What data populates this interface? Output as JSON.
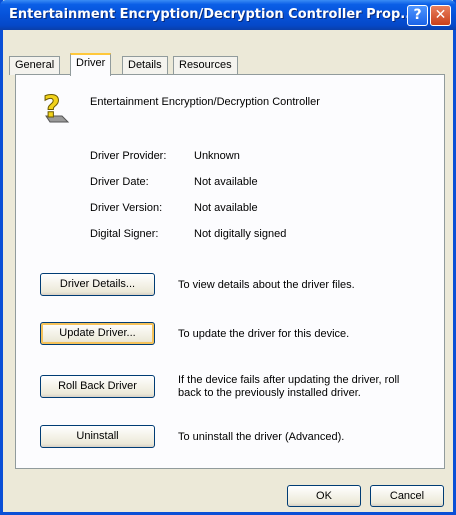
{
  "window": {
    "title": "Entertainment Encryption/Decryption Controller Prop...",
    "help_glyph": "?",
    "close_glyph": "✕"
  },
  "tabs": [
    {
      "label": "General"
    },
    {
      "label": "Driver",
      "active": true
    },
    {
      "label": "Details"
    },
    {
      "label": "Resources"
    }
  ],
  "device": {
    "icon": "unknown-device-icon",
    "name": "Entertainment Encryption/Decryption Controller"
  },
  "info": [
    {
      "label": "Driver Provider:",
      "value": "Unknown"
    },
    {
      "label": "Driver Date:",
      "value": "Not available"
    },
    {
      "label": "Driver Version:",
      "value": "Not available"
    },
    {
      "label": "Digital Signer:",
      "value": "Not digitally signed"
    }
  ],
  "actions": [
    {
      "button": "Driver Details...",
      "description": "To view details about the driver files."
    },
    {
      "button": "Update Driver...",
      "description": "To update the driver for this device."
    },
    {
      "button": "Roll Back Driver",
      "description": "If the device fails after updating the driver, roll back to the previously installed driver."
    },
    {
      "button": "Uninstall",
      "description": "To uninstall the driver (Advanced)."
    }
  ],
  "footer": {
    "ok_label": "OK",
    "cancel_label": "Cancel"
  },
  "colors": {
    "titlebar": "#0652d9",
    "dialog_bg": "#ece9d8",
    "panel_bg": "#fcfcfe",
    "focus_highlight": "#f5c25a"
  }
}
